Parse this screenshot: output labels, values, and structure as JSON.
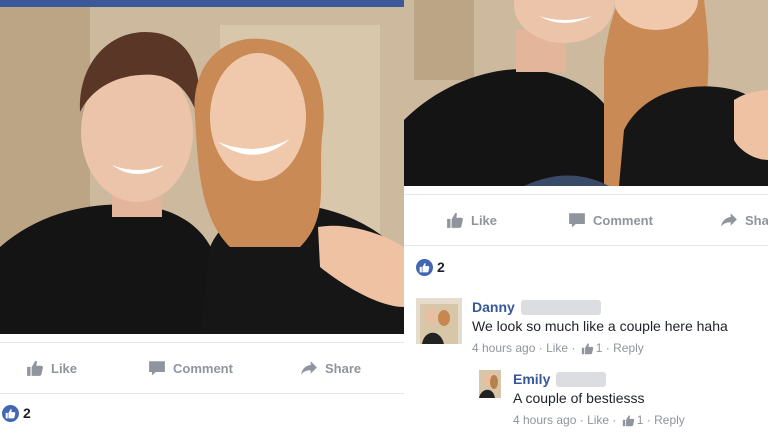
{
  "left_post": {
    "actions": {
      "like": "Like",
      "comment": "Comment",
      "share": "Share"
    },
    "reaction_count": "2"
  },
  "right_post": {
    "actions": {
      "like": "Like",
      "comment": "Comment",
      "share": "Sha"
    },
    "reaction_count": "2",
    "comments": [
      {
        "author": "Danny",
        "text": "We look so much like a couple here haha",
        "time": "4 hours ago",
        "like_label": "Like",
        "like_count": "1",
        "reply_label": "Reply"
      },
      {
        "author": "Emily",
        "text": "A couple of bestiesss",
        "time": "4 hours ago",
        "like_label": "Like",
        "like_count": "1",
        "reply_label": "Reply"
      }
    ]
  },
  "colors": {
    "facebook_blue": "#3b5998",
    "link_blue": "#365899",
    "muted_gray": "#90949c",
    "like_blue": "#4267b2"
  },
  "icons": [
    "thumbs-up-icon",
    "comment-icon",
    "share-arrow-icon"
  ]
}
